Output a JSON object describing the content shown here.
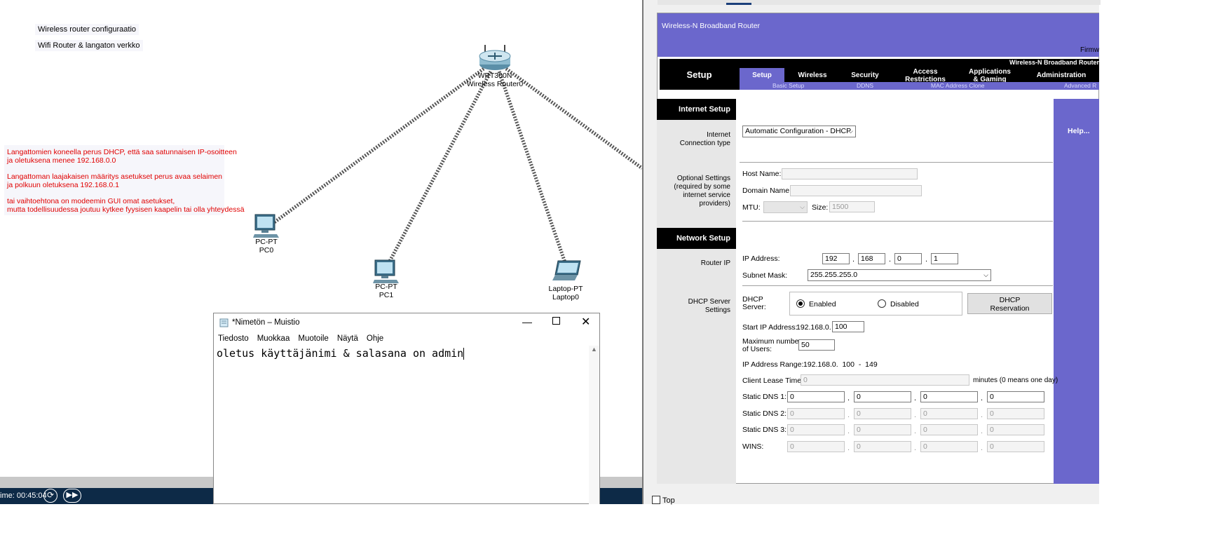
{
  "workspace": {
    "notes": [
      "Wireless router configuraatio",
      "Wifi Router & langaton verkko"
    ],
    "red_note_lines": [
      "Langattomien koneella perus DHCP, että saa satunnaisen IP-osoitteen",
      "ja oletuksena menee 192.168.0.0",
      "Langattoman laajakaisen määritys asetukset perus avaa selaimen",
      "ja polkuun oletuksena 192.168.0.1",
      "tai vaihtoehtona on modeemin GUI omat asetukset,",
      "mutta todellisuudessa joutuu kytkee fyysisen kaapelin tai olla yhteydessä"
    ],
    "devices": {
      "router": {
        "model": "WRT300N",
        "name": "Wireless Router0"
      },
      "pc0": {
        "model": "PC-PT",
        "name": "PC0"
      },
      "pc1": {
        "model": "PC-PT",
        "name": "PC1"
      },
      "laptop0": {
        "model": "Laptop-PT",
        "name": "Laptop0"
      }
    },
    "time_label": "ime: 00:45:04"
  },
  "notepad": {
    "title": "*Nimetön – Muistio",
    "menu": [
      "Tiedosto",
      "Muokkaa",
      "Muotoile",
      "Näytä",
      "Ohje"
    ],
    "content": "oletus käyttäjänimi & salasana on admin"
  },
  "router_gui": {
    "header_title": "Wireless-N Broadband Router",
    "firmware_label": "Firmw",
    "brand_right": "Wireless-N Broadband Router",
    "setup_title": "Setup",
    "tabs": [
      "Setup",
      "Wireless",
      "Security",
      "Access\nRestrictions",
      "Applications\n& Gaming",
      "Administration"
    ],
    "subtabs": [
      "Basic Setup",
      "DDNS",
      "MAC Address Clone",
      "Advanced R"
    ],
    "sections": {
      "internet": "Internet Setup",
      "network": "Network Setup"
    },
    "help_label": "Help...",
    "internet": {
      "conn_type_label": "Internet\nConnection type",
      "conn_type_value": "Automatic Configuration - DHCP",
      "optional_label": "Optional Settings\n(required by some\ninternet service\nproviders)",
      "host_name_label": "Host Name:",
      "domain_name_label": "Domain Name:",
      "mtu_label": "MTU:",
      "size_label": "Size:",
      "size_value": "1500"
    },
    "network": {
      "router_ip_label": "Router IP",
      "ip_label": "IP Address:",
      "ip": [
        "192",
        "168",
        "0",
        "1"
      ],
      "subnet_label": "Subnet Mask:",
      "subnet_value": "255.255.255.0",
      "dhcp_settings_label": "DHCP Server\nSettings",
      "dhcp_server_label": "DHCP\nServer:",
      "enabled_label": "Enabled",
      "disabled_label": "Disabled",
      "dhcp_enabled": true,
      "reservation_button": "DHCP\nReservation",
      "start_ip_label": "Start IP Address:",
      "start_ip_prefix": "192.168.0.",
      "start_ip_value": "100",
      "max_users_label": "Maximum number\nof Users:",
      "max_users_value": "50",
      "range_label": "IP Address Range:",
      "range_value": "192.168.0.  100  -  149",
      "lease_label": "Client Lease Time:",
      "lease_value": "0",
      "lease_suffix": "minutes (0 means one day)",
      "dns1_label": "Static DNS 1:",
      "dns1": [
        "0",
        "0",
        "0",
        "0"
      ],
      "dns2_label": "Static DNS 2:",
      "dns2": [
        "0",
        "0",
        "0",
        "0"
      ],
      "dns3_label": "Static DNS 3:",
      "dns3": [
        "0",
        "0",
        "0",
        "0"
      ],
      "wins_label": "WINS:",
      "wins": [
        "0",
        "0",
        "0",
        "0"
      ]
    },
    "top_checkbox_label": "Top",
    "top_checked": false
  },
  "colors": {
    "router_purple": "#6b67cc",
    "red_note": "#e00000",
    "taskbar": "#0d2a47"
  }
}
